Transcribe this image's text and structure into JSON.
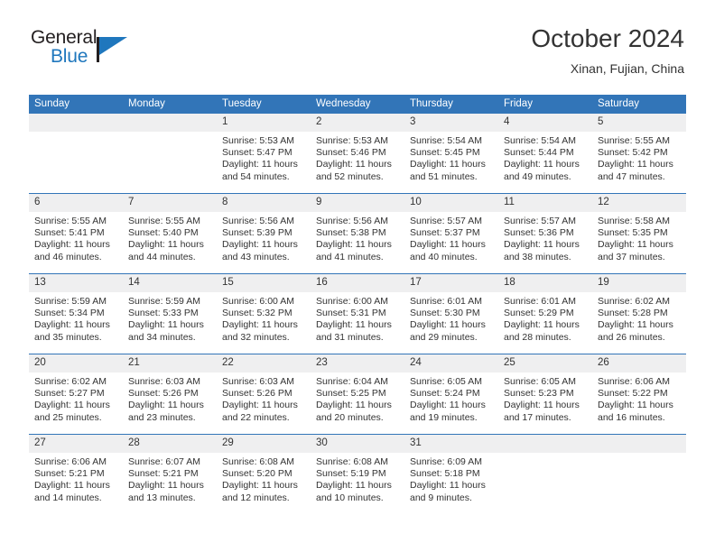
{
  "brand": {
    "name_part1": "General",
    "name_part2": "Blue",
    "accent_color": "#1f77bd"
  },
  "header": {
    "title": "October 2024",
    "location": "Xinan, Fujian, China"
  },
  "theme": {
    "header_blue": "#3275b8",
    "daynum_band": "#efeff0",
    "text": "#333333"
  },
  "weekdays": [
    "Sunday",
    "Monday",
    "Tuesday",
    "Wednesday",
    "Thursday",
    "Friday",
    "Saturday"
  ],
  "weeks": [
    [
      {
        "day": "",
        "sunrise": "",
        "sunset": "",
        "daylight1": "",
        "daylight2": "",
        "blank": true
      },
      {
        "day": "",
        "sunrise": "",
        "sunset": "",
        "daylight1": "",
        "daylight2": "",
        "blank": true
      },
      {
        "day": "1",
        "sunrise": "Sunrise: 5:53 AM",
        "sunset": "Sunset: 5:47 PM",
        "daylight1": "Daylight: 11 hours",
        "daylight2": "and 54 minutes."
      },
      {
        "day": "2",
        "sunrise": "Sunrise: 5:53 AM",
        "sunset": "Sunset: 5:46 PM",
        "daylight1": "Daylight: 11 hours",
        "daylight2": "and 52 minutes."
      },
      {
        "day": "3",
        "sunrise": "Sunrise: 5:54 AM",
        "sunset": "Sunset: 5:45 PM",
        "daylight1": "Daylight: 11 hours",
        "daylight2": "and 51 minutes."
      },
      {
        "day": "4",
        "sunrise": "Sunrise: 5:54 AM",
        "sunset": "Sunset: 5:44 PM",
        "daylight1": "Daylight: 11 hours",
        "daylight2": "and 49 minutes."
      },
      {
        "day": "5",
        "sunrise": "Sunrise: 5:55 AM",
        "sunset": "Sunset: 5:42 PM",
        "daylight1": "Daylight: 11 hours",
        "daylight2": "and 47 minutes."
      }
    ],
    [
      {
        "day": "6",
        "sunrise": "Sunrise: 5:55 AM",
        "sunset": "Sunset: 5:41 PM",
        "daylight1": "Daylight: 11 hours",
        "daylight2": "and 46 minutes."
      },
      {
        "day": "7",
        "sunrise": "Sunrise: 5:55 AM",
        "sunset": "Sunset: 5:40 PM",
        "daylight1": "Daylight: 11 hours",
        "daylight2": "and 44 minutes."
      },
      {
        "day": "8",
        "sunrise": "Sunrise: 5:56 AM",
        "sunset": "Sunset: 5:39 PM",
        "daylight1": "Daylight: 11 hours",
        "daylight2": "and 43 minutes."
      },
      {
        "day": "9",
        "sunrise": "Sunrise: 5:56 AM",
        "sunset": "Sunset: 5:38 PM",
        "daylight1": "Daylight: 11 hours",
        "daylight2": "and 41 minutes."
      },
      {
        "day": "10",
        "sunrise": "Sunrise: 5:57 AM",
        "sunset": "Sunset: 5:37 PM",
        "daylight1": "Daylight: 11 hours",
        "daylight2": "and 40 minutes."
      },
      {
        "day": "11",
        "sunrise": "Sunrise: 5:57 AM",
        "sunset": "Sunset: 5:36 PM",
        "daylight1": "Daylight: 11 hours",
        "daylight2": "and 38 minutes."
      },
      {
        "day": "12",
        "sunrise": "Sunrise: 5:58 AM",
        "sunset": "Sunset: 5:35 PM",
        "daylight1": "Daylight: 11 hours",
        "daylight2": "and 37 minutes."
      }
    ],
    [
      {
        "day": "13",
        "sunrise": "Sunrise: 5:59 AM",
        "sunset": "Sunset: 5:34 PM",
        "daylight1": "Daylight: 11 hours",
        "daylight2": "and 35 minutes."
      },
      {
        "day": "14",
        "sunrise": "Sunrise: 5:59 AM",
        "sunset": "Sunset: 5:33 PM",
        "daylight1": "Daylight: 11 hours",
        "daylight2": "and 34 minutes."
      },
      {
        "day": "15",
        "sunrise": "Sunrise: 6:00 AM",
        "sunset": "Sunset: 5:32 PM",
        "daylight1": "Daylight: 11 hours",
        "daylight2": "and 32 minutes."
      },
      {
        "day": "16",
        "sunrise": "Sunrise: 6:00 AM",
        "sunset": "Sunset: 5:31 PM",
        "daylight1": "Daylight: 11 hours",
        "daylight2": "and 31 minutes."
      },
      {
        "day": "17",
        "sunrise": "Sunrise: 6:01 AM",
        "sunset": "Sunset: 5:30 PM",
        "daylight1": "Daylight: 11 hours",
        "daylight2": "and 29 minutes."
      },
      {
        "day": "18",
        "sunrise": "Sunrise: 6:01 AM",
        "sunset": "Sunset: 5:29 PM",
        "daylight1": "Daylight: 11 hours",
        "daylight2": "and 28 minutes."
      },
      {
        "day": "19",
        "sunrise": "Sunrise: 6:02 AM",
        "sunset": "Sunset: 5:28 PM",
        "daylight1": "Daylight: 11 hours",
        "daylight2": "and 26 minutes."
      }
    ],
    [
      {
        "day": "20",
        "sunrise": "Sunrise: 6:02 AM",
        "sunset": "Sunset: 5:27 PM",
        "daylight1": "Daylight: 11 hours",
        "daylight2": "and 25 minutes."
      },
      {
        "day": "21",
        "sunrise": "Sunrise: 6:03 AM",
        "sunset": "Sunset: 5:26 PM",
        "daylight1": "Daylight: 11 hours",
        "daylight2": "and 23 minutes."
      },
      {
        "day": "22",
        "sunrise": "Sunrise: 6:03 AM",
        "sunset": "Sunset: 5:26 PM",
        "daylight1": "Daylight: 11 hours",
        "daylight2": "and 22 minutes."
      },
      {
        "day": "23",
        "sunrise": "Sunrise: 6:04 AM",
        "sunset": "Sunset: 5:25 PM",
        "daylight1": "Daylight: 11 hours",
        "daylight2": "and 20 minutes."
      },
      {
        "day": "24",
        "sunrise": "Sunrise: 6:05 AM",
        "sunset": "Sunset: 5:24 PM",
        "daylight1": "Daylight: 11 hours",
        "daylight2": "and 19 minutes."
      },
      {
        "day": "25",
        "sunrise": "Sunrise: 6:05 AM",
        "sunset": "Sunset: 5:23 PM",
        "daylight1": "Daylight: 11 hours",
        "daylight2": "and 17 minutes."
      },
      {
        "day": "26",
        "sunrise": "Sunrise: 6:06 AM",
        "sunset": "Sunset: 5:22 PM",
        "daylight1": "Daylight: 11 hours",
        "daylight2": "and 16 minutes."
      }
    ],
    [
      {
        "day": "27",
        "sunrise": "Sunrise: 6:06 AM",
        "sunset": "Sunset: 5:21 PM",
        "daylight1": "Daylight: 11 hours",
        "daylight2": "and 14 minutes."
      },
      {
        "day": "28",
        "sunrise": "Sunrise: 6:07 AM",
        "sunset": "Sunset: 5:21 PM",
        "daylight1": "Daylight: 11 hours",
        "daylight2": "and 13 minutes."
      },
      {
        "day": "29",
        "sunrise": "Sunrise: 6:08 AM",
        "sunset": "Sunset: 5:20 PM",
        "daylight1": "Daylight: 11 hours",
        "daylight2": "and 12 minutes."
      },
      {
        "day": "30",
        "sunrise": "Sunrise: 6:08 AM",
        "sunset": "Sunset: 5:19 PM",
        "daylight1": "Daylight: 11 hours",
        "daylight2": "and 10 minutes."
      },
      {
        "day": "31",
        "sunrise": "Sunrise: 6:09 AM",
        "sunset": "Sunset: 5:18 PM",
        "daylight1": "Daylight: 11 hours",
        "daylight2": "and 9 minutes."
      },
      {
        "day": "",
        "sunrise": "",
        "sunset": "",
        "daylight1": "",
        "daylight2": "",
        "blank": true
      },
      {
        "day": "",
        "sunrise": "",
        "sunset": "",
        "daylight1": "",
        "daylight2": "",
        "blank": true
      }
    ]
  ]
}
